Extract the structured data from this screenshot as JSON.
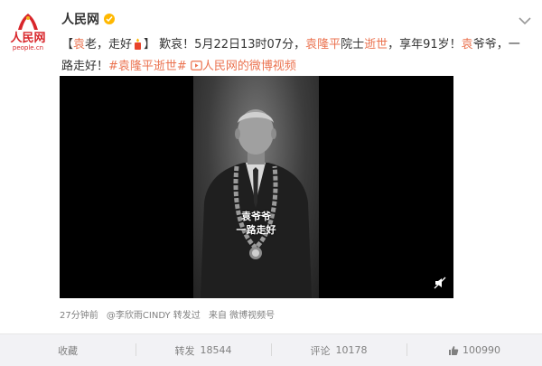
{
  "header": {
    "logo_text": "人民网",
    "logo_domain": "people.cn",
    "account_name": "人民网",
    "brand_color": "#d8262b",
    "verified_color": "#ffb800"
  },
  "post": {
    "segments": [
      {
        "text": "【",
        "style": "plain"
      },
      {
        "text": "袁",
        "style": "red"
      },
      {
        "text": "老，走好",
        "style": "plain"
      },
      {
        "text": "】 歎哀！5月22日13时07分，",
        "style": "plain"
      },
      {
        "text": "袁隆平",
        "style": "red"
      },
      {
        "text": "院士",
        "style": "plain"
      },
      {
        "text": "逝世",
        "style": "red"
      },
      {
        "text": "，享年91岁！",
        "style": "plain"
      },
      {
        "text": "袁",
        "style": "red"
      },
      {
        "text": "爷爷，一路走好！",
        "style": "plain"
      },
      {
        "text": "#袁隆平逝世#",
        "style": "link"
      },
      {
        "text": "人民网的微博视频",
        "style": "link"
      }
    ],
    "link_color": "#eb7350"
  },
  "video": {
    "subtitle_line1": "袁爷爷",
    "subtitle_line2": "一路走好"
  },
  "meta": {
    "time": "27分钟前",
    "forwarded_by": "@李欣雨CINDY 转发过",
    "source": "来自 微博视频号"
  },
  "actions": {
    "favorite_label": "收藏",
    "repost_label": "转发",
    "repost_count": "18544",
    "comment_label": "评论",
    "comment_count": "10178",
    "like_count": "100990"
  }
}
